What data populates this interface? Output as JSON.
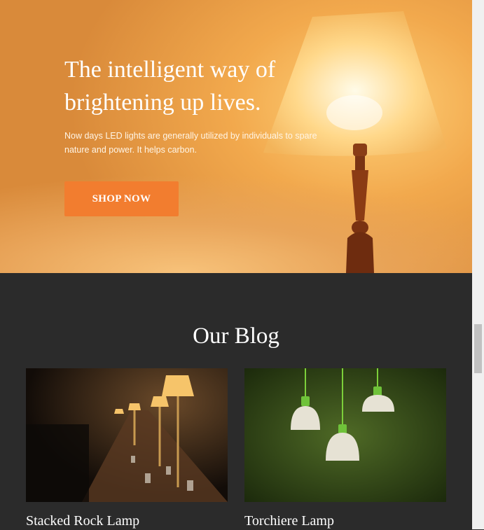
{
  "hero": {
    "title": "The intelligent way of brightening up lives.",
    "subtitle": "Now days LED lights are generally utilized by individuals to spare nature and power. It helps carbon.",
    "button_label": "SHOP NOW",
    "accent_color": "#f27d2f"
  },
  "blog": {
    "heading": "Our Blog",
    "posts": [
      {
        "title": "Stacked Rock Lamp",
        "image": "dining-hall-lamps-photo"
      },
      {
        "title": "Torchiere Lamp",
        "image": "pendant-lamps-on-grass-photo"
      }
    ]
  }
}
